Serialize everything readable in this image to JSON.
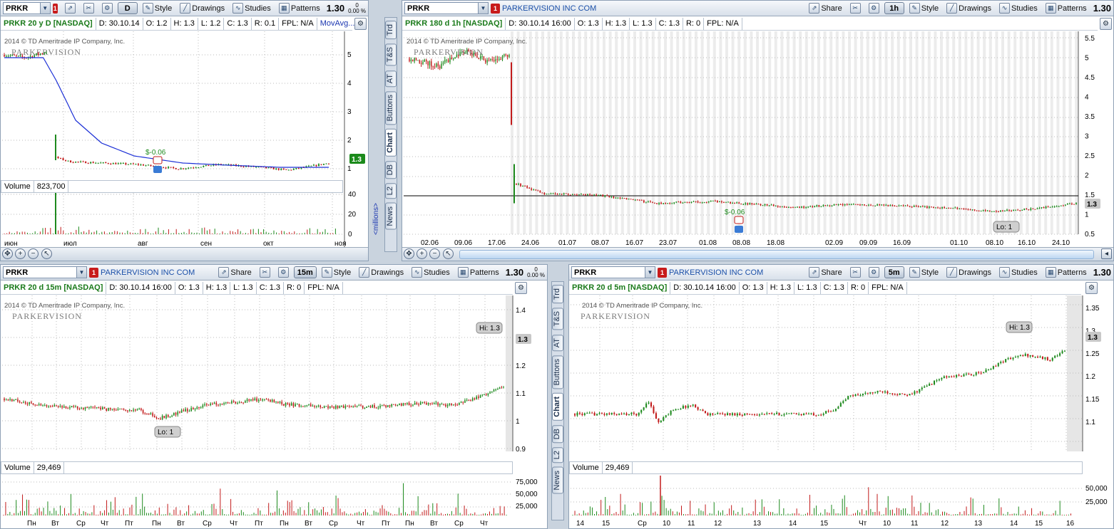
{
  "icons": [
    "dropdown-arrow-icon",
    "share-icon",
    "tools-icon",
    "style-icon",
    "drawings-icon",
    "studies-icon",
    "patterns-icon",
    "settings-icon",
    "zoom-in-icon",
    "zoom-out-icon",
    "pan-icon",
    "cursor-icon",
    "scroll-arrow-icon"
  ],
  "vtabs": {
    "left": [
      "Trd",
      "T&S",
      "AT",
      "Buttons",
      "Chart",
      "DB",
      "L2",
      "News"
    ],
    "mid": [
      "Trd",
      "T&S",
      "AT",
      "Buttons",
      "Chart",
      "DB",
      "L2",
      "News"
    ]
  },
  "colors": {
    "up": "#1e8a1e",
    "down": "#c21b1b",
    "ma": "#1b2fd6",
    "accent": "#1a4fa8",
    "bg": "#c9d3de"
  },
  "common": {
    "share": "Share",
    "style": "Style",
    "drawings": "Drawings",
    "studies": "Studies",
    "patterns": "Patterns",
    "copyright": "2014 © TD Ameritrade IP Company, Inc.",
    "logo": "PARKERVISION",
    "volume_label": "Volume"
  },
  "panes": {
    "tl": {
      "symbol": "PRKR",
      "company": "",
      "agg": "D",
      "price": "1.30",
      "change_top": "0",
      "change_bot": "0.00 %",
      "desc": "PRKR 20 y D [NASDAQ]",
      "date": "D: 30.10.14",
      "o": "O: 1.2",
      "h": "H: 1.3",
      "l": "L: 1.2",
      "c": "C: 1.3",
      "r": "R: 0.1",
      "fpl": "FPL: N/A",
      "study": "MovAvg...",
      "last_label": "1.3",
      "annot": "$-0.06",
      "volume": "823,700",
      "yticks": [
        "5",
        "4",
        "3",
        "2",
        "1"
      ],
      "vticks": [
        "40",
        "20",
        "0"
      ],
      "vunit": "<millions>",
      "xticks": [
        "июн",
        "июл",
        "авг",
        "сен",
        "окт",
        "ноя"
      ]
    },
    "tr": {
      "symbol": "PRKR",
      "company": "PARKERVISION INC COM",
      "agg": "1h",
      "price": "1.30",
      "change_top": "0",
      "change_bot": "0.00 %",
      "desc": "PRKR 180 d 1h [NASDAQ]",
      "date": "D: 30.10.14 16:00",
      "o": "O: 1.3",
      "h": "H: 1.3",
      "l": "L: 1.3",
      "c": "C: 1.3",
      "r": "R: 0",
      "fpl": "FPL: N/A",
      "last_label": "1.3",
      "annot": "$-0.06",
      "lo": "Lo: 1",
      "yticks": [
        "5.5",
        "5",
        "4.5",
        "4",
        "3.5",
        "3",
        "2.5",
        "2",
        "1.5",
        "1",
        "0.5"
      ],
      "xticks": [
        "02.06",
        "09.06",
        "17.06",
        "24.06",
        "01.07",
        "08.07",
        "16.07",
        "23.07",
        "01.08",
        "08.08",
        "18.08",
        "02.09",
        "09.09",
        "16.09",
        "01.10",
        "08.10",
        "16.10",
        "24.10"
      ]
    },
    "bl": {
      "symbol": "PRKR",
      "company": "PARKERVISION INC COM",
      "agg": "15m",
      "price": "1.30",
      "change_top": "0",
      "change_bot": "0.00 %",
      "desc": "PRKR 20 d 15m [NASDAQ]",
      "date": "D: 30.10.14 16:00",
      "o": "O: 1.3",
      "h": "H: 1.3",
      "l": "L: 1.3",
      "c": "C: 1.3",
      "r": "R: 0",
      "fpl": "FPL: N/A",
      "last_label": "1.3",
      "hi": "Hi: 1.3",
      "lo": "Lo: 1",
      "volume": "29,469",
      "yticks": [
        "1.4",
        "1.3",
        "1.2",
        "1.1",
        "1",
        "0.9"
      ],
      "vticks": [
        "75,000",
        "50,000",
        "25,000"
      ],
      "xticks": [
        "Пн",
        "Вт",
        "Ср",
        "Чт",
        "Пт",
        "Пн",
        "Вт",
        "Ср",
        "Чт",
        "Пт",
        "Пн",
        "Вт",
        "Ср",
        "Чт",
        "Пт",
        "Пн",
        "Вт",
        "Ср",
        "Чт"
      ]
    },
    "br": {
      "symbol": "PRKR",
      "company": "PARKERVISION INC COM",
      "agg": "5m",
      "price": "1.30",
      "desc": "PRKR 20 d 5m [NASDAQ]",
      "date": "D: 30.10.14 16:00",
      "o": "O: 1.3",
      "h": "H: 1.3",
      "l": "L: 1.3",
      "c": "C: 1.3",
      "r": "R: 0",
      "fpl": "FPL: N/A",
      "last_label": "1.3",
      "hi": "Hi: 1.3",
      "volume": "29,469",
      "yticks": [
        "1.35",
        "1.3",
        "1.25",
        "1.2",
        "1.15",
        "1.1"
      ],
      "vticks": [
        "50,000",
        "25,000"
      ],
      "xticks": [
        "14",
        "15",
        "Ср",
        "10",
        "11",
        "12",
        "13",
        "14",
        "15",
        "Чт",
        "10",
        "11",
        "12",
        "13",
        "14",
        "15",
        "16"
      ]
    }
  }
}
